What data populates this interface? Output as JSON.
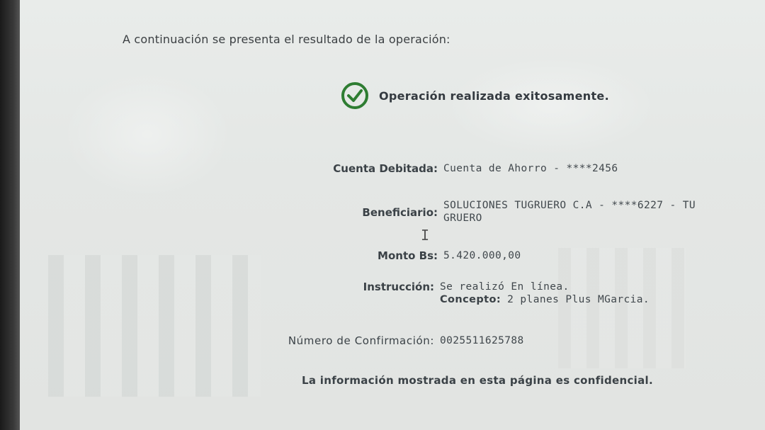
{
  "intro": "A continuación se presenta el resultado de la operación:",
  "status": {
    "message": "Operación realizada exitosamente.",
    "icon": "check-circle-icon",
    "color": "#2e7d32"
  },
  "details": {
    "cuenta_debitada": {
      "label": "Cuenta Debitada:",
      "value": "Cuenta de Ahorro - ****2456"
    },
    "beneficiario": {
      "label": "Beneficiario:",
      "value": "SOLUCIONES TUGRUERO C.A - ****6227 - TU GRUERO"
    },
    "monto": {
      "label": "Monto Bs:",
      "value": "5.420.000,00"
    },
    "instruccion": {
      "label": "Instrucción:",
      "value": "Se realizó En línea.",
      "concepto_label": "Concepto:",
      "concepto_value": "2 planes Plus MGarcia."
    },
    "confirmacion": {
      "label": "Número de Confirmación:",
      "value": "0025511625788"
    }
  },
  "footer": "La información mostrada en esta página es confidencial."
}
